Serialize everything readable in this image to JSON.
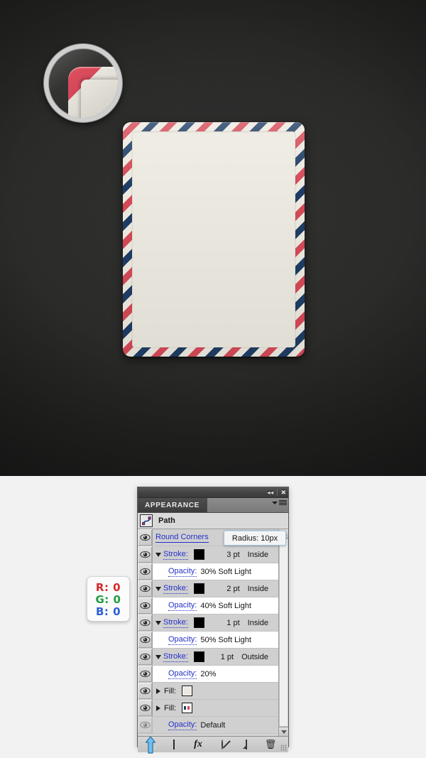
{
  "canvas": {
    "background_color": "#2a2a29",
    "artwork": {
      "name": "airmail-envelope",
      "stripe_red": "#d44a57",
      "stripe_navy": "#1f3d64",
      "paper_cream": "#ece9e0",
      "corner_radius_px": 11
    },
    "loupe": {
      "name": "magnifier-preview",
      "ring_color": "#cfcfcf"
    }
  },
  "color_readout": {
    "name": "rgb-readout",
    "r_label": "R: 0",
    "g_label": "G: 0",
    "b_label": "B: 0",
    "r_color": "#d42a2a",
    "g_color": "#1f9c3f",
    "b_color": "#2a5fd4"
  },
  "panel": {
    "title_bar": {
      "collapse_glyph": "◂◂",
      "separator": "|",
      "close_glyph": "✖"
    },
    "tab": {
      "label": "APPEARANCE",
      "menu_name": "panel-menu-button"
    },
    "object": {
      "icon_name": "path-icon",
      "name": "Path"
    },
    "tooltip": {
      "name": "radius-tooltip",
      "text": "Radius: 10px",
      "border_color": "#9ec4e0"
    },
    "rows": [
      {
        "kind": "effect",
        "name": "round-corners",
        "visible": true,
        "label": "Round Corners",
        "label_style": "link-solid",
        "indent": false,
        "disclosure": "none",
        "swatch": "none",
        "value": "",
        "blend": "",
        "shade": "shade"
      },
      {
        "kind": "stroke",
        "name": "stroke-3pt-inside",
        "visible": true,
        "label": "Stroke:",
        "label_style": "link-dotted",
        "indent": false,
        "disclosure": "down",
        "swatch": "black",
        "value": "3 pt",
        "blend": "Inside",
        "shade": "shade"
      },
      {
        "kind": "opacity",
        "name": "opacity-30-soft-light",
        "visible": true,
        "label": "Opacity:",
        "label_style": "link-dotted",
        "indent": true,
        "disclosure": "none",
        "swatch": "none",
        "value": "30% Soft Light",
        "blend": "",
        "shade": "light"
      },
      {
        "kind": "stroke",
        "name": "stroke-2pt-inside",
        "visible": true,
        "label": "Stroke:",
        "label_style": "link-dotted",
        "indent": false,
        "disclosure": "down",
        "swatch": "black",
        "value": "2 pt",
        "blend": "Inside",
        "shade": "shade"
      },
      {
        "kind": "opacity",
        "name": "opacity-40-soft-light",
        "visible": true,
        "label": "Opacity:",
        "label_style": "link-dotted",
        "indent": true,
        "disclosure": "none",
        "swatch": "none",
        "value": "40% Soft Light",
        "blend": "",
        "shade": "light"
      },
      {
        "kind": "stroke",
        "name": "stroke-1pt-inside",
        "visible": true,
        "label": "Stroke:",
        "label_style": "link-dotted",
        "indent": false,
        "disclosure": "down",
        "swatch": "black",
        "value": "1 pt",
        "blend": "Inside",
        "shade": "shade"
      },
      {
        "kind": "opacity",
        "name": "opacity-50-soft-light",
        "visible": true,
        "label": "Opacity:",
        "label_style": "link-dotted",
        "indent": true,
        "disclosure": "none",
        "swatch": "none",
        "value": "50% Soft Light",
        "blend": "",
        "shade": "light"
      },
      {
        "kind": "stroke",
        "name": "stroke-1pt-outside",
        "visible": true,
        "label": "Stroke:",
        "label_style": "link-dotted",
        "indent": false,
        "disclosure": "down",
        "swatch": "black",
        "value": "1 pt",
        "blend": "Outside",
        "shade": "shade"
      },
      {
        "kind": "opacity",
        "name": "opacity-20",
        "visible": true,
        "label": "Opacity:",
        "label_style": "link-dotted",
        "indent": true,
        "disclosure": "none",
        "swatch": "none",
        "value": "20%",
        "blend": "",
        "shade": "light"
      },
      {
        "kind": "fill",
        "name": "fill-cream",
        "visible": true,
        "label": "Fill:",
        "label_style": "plain",
        "indent": false,
        "disclosure": "right",
        "swatch": "cream",
        "value": "",
        "blend": "",
        "shade": "shade"
      },
      {
        "kind": "fill",
        "name": "fill-airmail-pattern",
        "visible": true,
        "label": "Fill:",
        "label_style": "plain",
        "indent": false,
        "disclosure": "right",
        "swatch": "pattern",
        "value": "",
        "blend": "",
        "shade": "shade"
      },
      {
        "kind": "opacity",
        "name": "opacity-default",
        "visible": false,
        "label": "Opacity:",
        "label_style": "link-dotted",
        "indent": true,
        "disclosure": "none",
        "swatch": "none",
        "value": "Default",
        "blend": "",
        "shade": "shade"
      }
    ],
    "footer_buttons": [
      {
        "name": "add-new-stroke-button",
        "icon": "new-stroke-icon",
        "label": ""
      },
      {
        "name": "add-new-fill-button",
        "icon": "new-fill-icon",
        "label": ""
      },
      {
        "name": "add-new-effect-button",
        "icon": "fx-icon",
        "label": "fx"
      },
      {
        "name": "clear-appearance-button",
        "icon": "clear-circle-slash-icon",
        "label": ""
      },
      {
        "name": "duplicate-item-button",
        "icon": "duplicate-icon",
        "label": ""
      },
      {
        "name": "delete-item-button",
        "icon": "trash-icon",
        "label": "🗑"
      }
    ],
    "scrollbar": {
      "name": "vertical-scrollbar"
    }
  },
  "cursor": {
    "name": "mouse-cursor",
    "color": "#4da3e8"
  }
}
